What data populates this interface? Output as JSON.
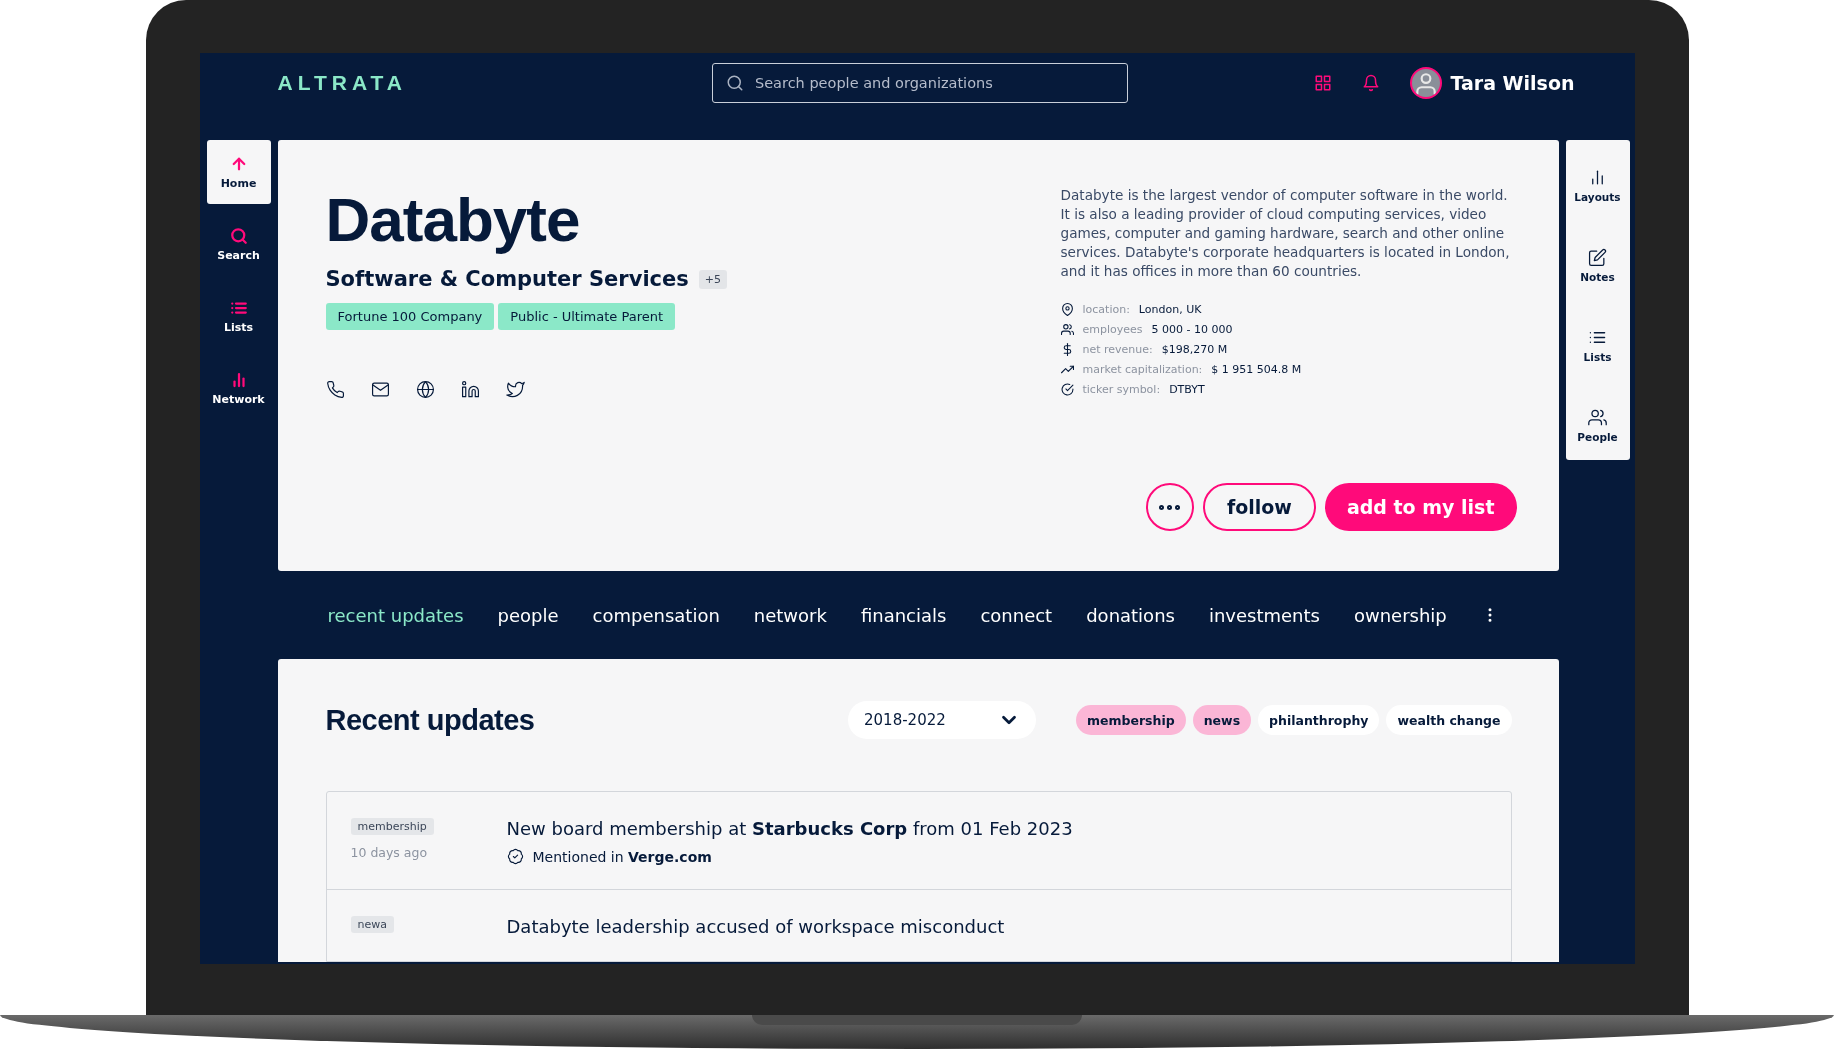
{
  "header": {
    "brand": "ALTRATA",
    "search": {
      "placeholder": "Search people and organizations"
    },
    "user": {
      "name": "Tara Wilson"
    }
  },
  "left_nav": [
    {
      "label": "Home",
      "selected": true
    },
    {
      "label": "Search",
      "selected": false
    },
    {
      "label": "Lists",
      "selected": false
    },
    {
      "label": "Network",
      "selected": false
    }
  ],
  "right_panel": [
    {
      "label": "Layouts"
    },
    {
      "label": "Notes"
    },
    {
      "label": "Lists"
    },
    {
      "label": "People"
    }
  ],
  "company": {
    "name": "Databyte",
    "industry": "Software & Computer Services",
    "extra_count": "+5",
    "tags": [
      "Fortune 100 Company",
      "Public - Ultimate Parent"
    ],
    "description": "Databyte is the largest vendor of computer software in the world. It is also a leading provider of cloud computing services, video games, computer and gaming hardware, search and other online services. Databyte's corporate headquarters is located in London, and it has offices in more than 60 countries.",
    "facts": [
      {
        "label": "location:",
        "value": "London, UK"
      },
      {
        "label": "employees",
        "value": "5 000 - 10 000"
      },
      {
        "label": "net revenue:",
        "value": "$198,270 M"
      },
      {
        "label": "market capitalization:",
        "value": "$ 1 951 504.8 M"
      },
      {
        "label": "ticker symbol:",
        "value": "DTBYT"
      }
    ],
    "actions": {
      "follow": "follow",
      "add": "add to my list"
    }
  },
  "tabs": [
    {
      "label": "recent updates",
      "selected": true
    },
    {
      "label": "people",
      "selected": false
    },
    {
      "label": "compensation",
      "selected": false
    },
    {
      "label": "network",
      "selected": false
    },
    {
      "label": "financials",
      "selected": false
    },
    {
      "label": "connect",
      "selected": false
    },
    {
      "label": "donations",
      "selected": false
    },
    {
      "label": "investments",
      "selected": false
    },
    {
      "label": "ownership",
      "selected": false
    }
  ],
  "updates": {
    "title": "Recent updates",
    "period": "2018-2022",
    "filters": [
      {
        "label": "membership",
        "selected": true
      },
      {
        "label": "news",
        "selected": true
      },
      {
        "label": "philanthrophy",
        "selected": false
      },
      {
        "label": "wealth change",
        "selected": false
      }
    ],
    "items": [
      {
        "tag": "membership",
        "time": "10 days ago",
        "headline": "New board membership at **Starbucks Corp** from 01 Feb 2023",
        "source": "Mentioned in **Verge.com**"
      },
      {
        "tag": "newa",
        "headline": "Databyte leadership accused of workspace misconduct"
      }
    ]
  }
}
